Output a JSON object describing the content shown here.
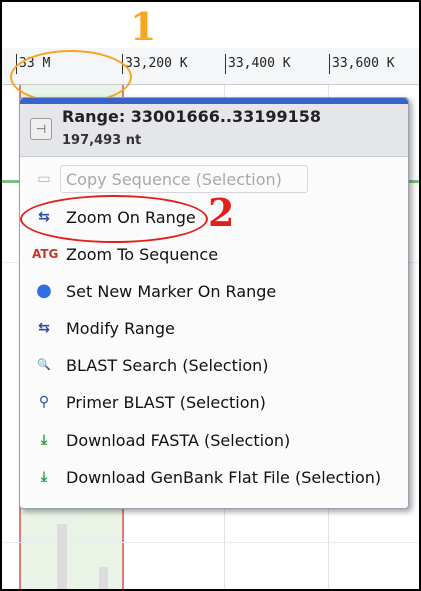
{
  "annotations": {
    "marker_1": "1",
    "marker_2": "2"
  },
  "ruler": {
    "ticks": [
      "33 M",
      "33,200 K",
      "33,400 K",
      "33,600 K"
    ]
  },
  "menu": {
    "range_label": "Range: 33001666..33199158",
    "length_label": "197,493 nt",
    "items": [
      {
        "label": "Copy Sequence (Selection)",
        "icon": "copy-icon",
        "disabled": true
      },
      {
        "label": "Zoom On Range",
        "icon": "zoom-range-icon",
        "disabled": false
      },
      {
        "label": "Zoom To Sequence",
        "icon": "zoom-sequence-icon",
        "disabled": false
      },
      {
        "label": "Set New Marker On Range",
        "icon": "marker-pin-icon",
        "disabled": false
      },
      {
        "label": "Modify Range",
        "icon": "modify-range-icon",
        "disabled": false
      },
      {
        "label": "BLAST Search (Selection)",
        "icon": "blast-icon",
        "disabled": false
      },
      {
        "label": "Primer BLAST (Selection)",
        "icon": "primer-blast-icon",
        "disabled": false
      },
      {
        "label": "Download FASTA (Selection)",
        "icon": "download-icon",
        "disabled": false
      },
      {
        "label": "Download GenBank Flat File (Selection)",
        "icon": "download-icon",
        "disabled": false
      }
    ]
  },
  "colors": {
    "annotation_orange": "#f5a623",
    "annotation_red": "#e0201a",
    "menu_header_blue": "#3a63c9",
    "selection_border": "#e07a7a"
  }
}
